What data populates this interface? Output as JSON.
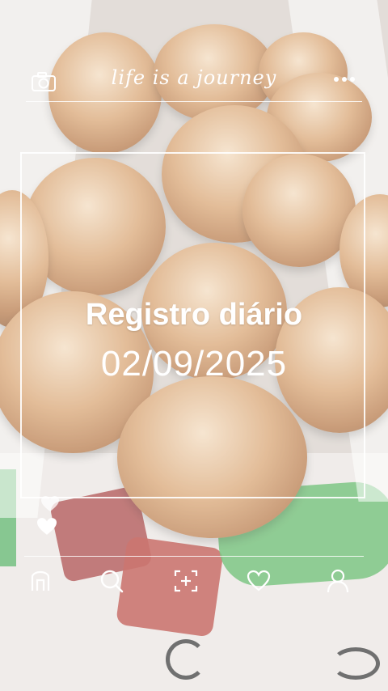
{
  "header": {
    "brand_text": "life is a journey",
    "camera_icon": "camera-icon",
    "more_icon": "more-icon"
  },
  "card": {
    "title": "Registro diário",
    "date": "02/09/2025"
  },
  "reactions": {
    "icons": [
      "heart-icon-small",
      "heart-icon-filled"
    ]
  },
  "nav": {
    "items": [
      "home-icon",
      "search-icon",
      "add-photo-icon",
      "heart-icon",
      "profile-icon"
    ]
  },
  "colors": {
    "overlay_text": "#ffffff",
    "lines": "#ffffff"
  }
}
